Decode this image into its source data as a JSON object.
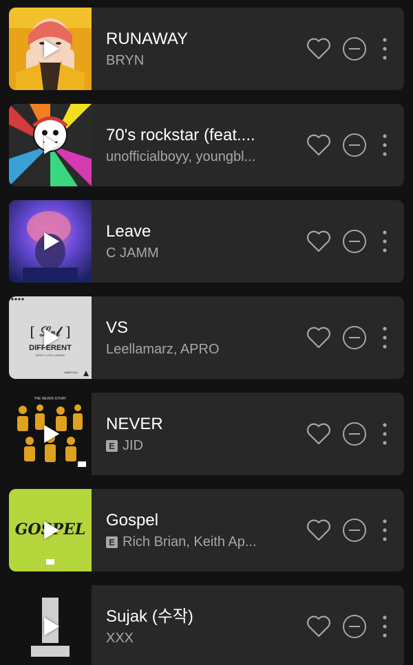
{
  "tracks": [
    {
      "title": "RUNAWAY",
      "artist": "BRYN",
      "explicit": false,
      "cover_colors": [
        "#e8a319",
        "#f2c02a",
        "#3a2a20"
      ]
    },
    {
      "title": "70's rockstar (feat....",
      "artist": "unofficialboyy, youngbl...",
      "explicit": false,
      "cover_colors": [
        "#d63a3a",
        "#3aa0d6",
        "#f0e020"
      ]
    },
    {
      "title": "Leave",
      "artist": "C JAMM",
      "explicit": false,
      "cover_colors": [
        "#6a4bd8",
        "#e07ab0",
        "#1b2060"
      ]
    },
    {
      "title": "VS",
      "artist": "Leellamarz, APRO",
      "explicit": false,
      "cover_colors": [
        "#d9d9d9",
        "#222222",
        "#ffffff"
      ],
      "cover_text_top": "[ 𝓛𝓮𝓵 ]",
      "cover_text_main": "DIFFERENT",
      "cover_text_sub": "APRO X LEELLAMARZ",
      "cover_text_corner": "AMBITION"
    },
    {
      "title": "NEVER",
      "artist": "JID",
      "explicit": true,
      "explicit_label": "E",
      "cover_colors": [
        "#111111",
        "#e0a020",
        "#ffffff"
      ],
      "cover_text_top": "THE NEVER STORY"
    },
    {
      "title": "Gospel",
      "artist": "Rich Brian, Keith Ap...",
      "explicit": true,
      "explicit_label": "E",
      "cover_colors": [
        "#b5d63c",
        "#1a1a1a",
        "#ffffff"
      ],
      "cover_text_main": "GOSPEL"
    },
    {
      "title": "Sujak (수작)",
      "artist": "XXX",
      "explicit": false,
      "cover_colors": [
        "#121212",
        "#d0d0d0",
        "#ffffff"
      ]
    }
  ],
  "icons": {
    "like": "heart-outline-icon",
    "remove": "minus-circle-icon",
    "more": "vertical-dots-icon",
    "play": "play-icon"
  }
}
